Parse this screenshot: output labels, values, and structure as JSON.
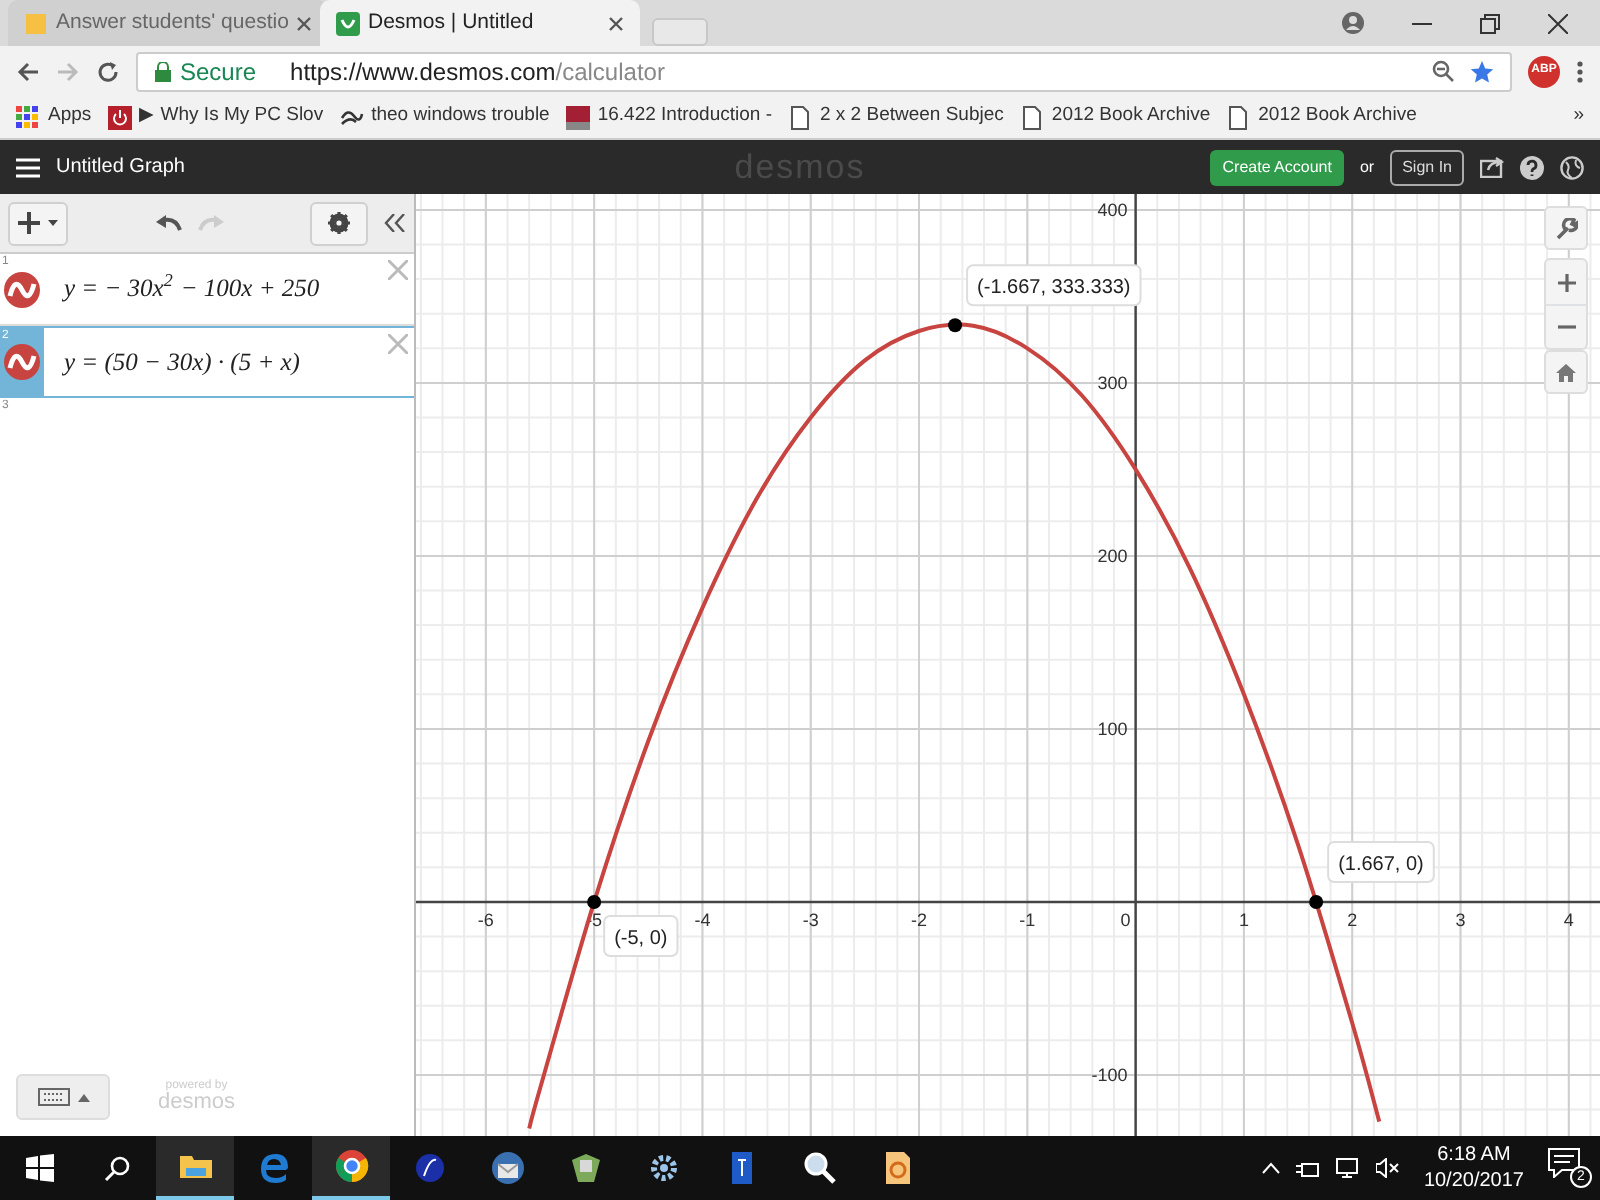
{
  "browser": {
    "tabs": [
      {
        "title": "Answer students' questio",
        "kind": "answers",
        "selected": false
      },
      {
        "title": "Desmos | Untitled",
        "kind": "desmos",
        "selected": true
      }
    ],
    "address": {
      "secure_label": "Secure",
      "url_host": "https://www.desmos.com",
      "url_path": "/calculator"
    },
    "extension_badge": "ABP",
    "bookmarks": [
      {
        "label": "Apps",
        "kind": "apps"
      },
      {
        "label": "▶ Why Is My PC Slov",
        "kind": "power"
      },
      {
        "label": "theo windows trouble",
        "kind": "swirl"
      },
      {
        "label": "16.422 Introduction -",
        "kind": "mit"
      },
      {
        "label": "2 x 2 Between Subjec",
        "kind": "page"
      },
      {
        "label": "2012 Book Archive",
        "kind": "page"
      },
      {
        "label": "2012 Book Archive",
        "kind": "page"
      }
    ],
    "bookmarks_overflow": "»"
  },
  "header": {
    "title": "Untitled Graph",
    "logo": "desmos",
    "create_account": "Create Account",
    "or": "or",
    "sign_in": "Sign In"
  },
  "expressions": [
    {
      "number": "1",
      "text": "y = − 30x$^{2}$ − 100x + 250",
      "selected": false
    },
    {
      "number": "2",
      "text": "y = (50 − 30x) · (5 + x)",
      "selected": true
    }
  ],
  "empty_row_number": "3",
  "footer": {
    "powered_by": "powered by",
    "logo": "desmos"
  },
  "graph": {
    "chart_data": {
      "type": "line",
      "grid": true,
      "xlim": [
        -6.645,
        4.288
      ],
      "ylim": [
        -135.3,
        409.2
      ],
      "xticks": [
        {
          "value": -6,
          "label": "-6"
        },
        {
          "value": -5,
          "label": "-5"
        },
        {
          "value": -4,
          "label": "-4"
        },
        {
          "value": -3,
          "label": "-3"
        },
        {
          "value": -2,
          "label": "-2"
        },
        {
          "value": -1,
          "label": "-1"
        },
        {
          "value": 0,
          "label": "0"
        },
        {
          "value": 1,
          "label": "1"
        },
        {
          "value": 2,
          "label": "2"
        },
        {
          "value": 3,
          "label": "3"
        },
        {
          "value": 4,
          "label": "4"
        }
      ],
      "yticks": [
        {
          "value": -100,
          "label": "-100"
        },
        {
          "value": 100,
          "label": "100"
        },
        {
          "value": 200,
          "label": "200"
        },
        {
          "value": 300,
          "label": "300"
        },
        {
          "value": 400,
          "label": "400"
        }
      ],
      "x": [
        -5.6,
        -5.5,
        -5,
        -4.5,
        -4,
        -3.5,
        -3,
        -2.5,
        -2,
        -1.5,
        -1,
        -0.5,
        0,
        0.5,
        1,
        1.5,
        2,
        2.25
      ],
      "series": [
        {
          "color": "#c74440",
          "values": [
            -131,
            -108,
            0,
            93,
            170,
            233,
            280,
            313,
            330,
            333,
            320,
            293,
            250,
            193,
            120,
            33,
            -70,
            -127
          ]
        }
      ],
      "annotations": [
        {
          "x": -1.667,
          "y": 333.333,
          "text": "(-1.667, 333.333)"
        },
        {
          "x": -5,
          "y": 0,
          "text": "(-5, 0)"
        },
        {
          "x": 1.667,
          "y": 0,
          "text": "(1.667, 0)"
        }
      ]
    }
  },
  "taskbar": {
    "apps": [
      {
        "kind": "folder",
        "running": true
      },
      {
        "kind": "edge",
        "running": false
      },
      {
        "kind": "chrome",
        "running": true
      },
      {
        "kind": "bluecircle",
        "running": false
      },
      {
        "kind": "mail",
        "running": false
      },
      {
        "kind": "map",
        "running": false
      },
      {
        "kind": "gearbox",
        "running": false
      },
      {
        "kind": "bluebar",
        "running": false
      },
      {
        "kind": "magnifier",
        "running": false
      },
      {
        "kind": "document",
        "running": false
      }
    ],
    "time": "6:18 AM",
    "date": "10/20/2017",
    "notifications": "2"
  }
}
